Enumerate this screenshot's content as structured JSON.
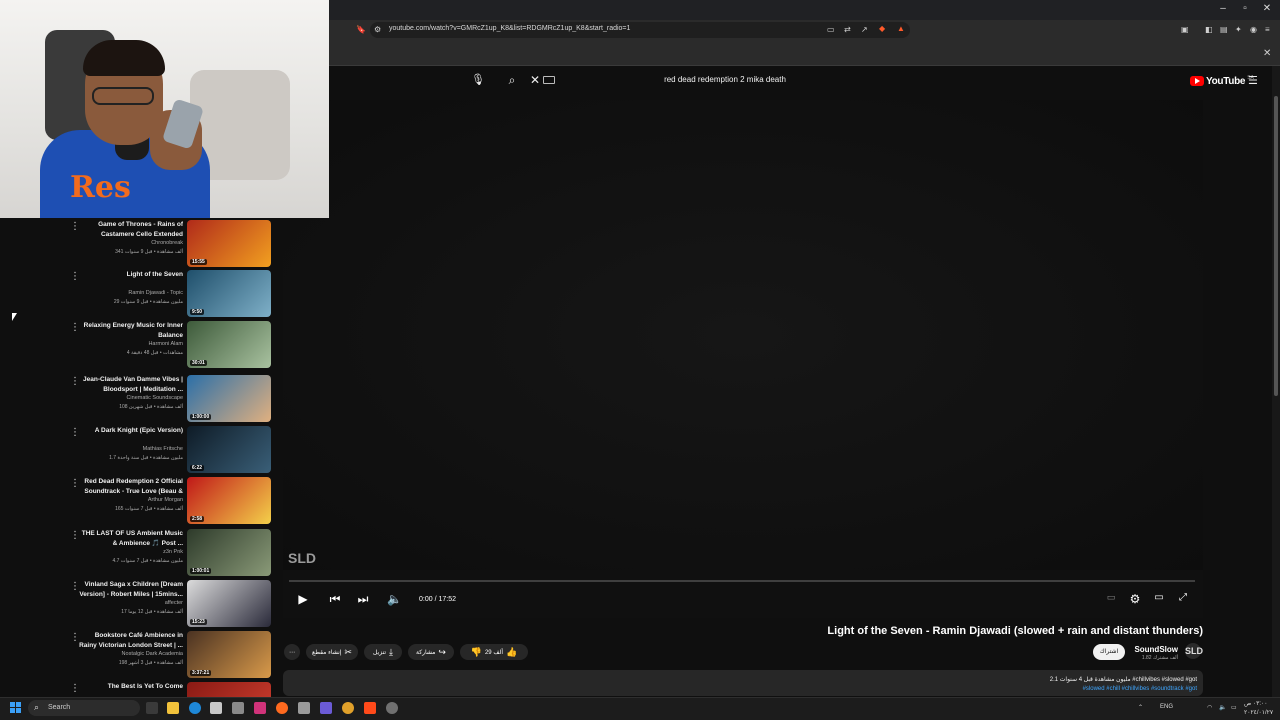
{
  "browser": {
    "url": "youtube.com/watch?v=GMRcZ1up_K8&list=RDGMRcZ1up_K8&start_radio=1",
    "window_controls": [
      "–",
      "▫",
      "✕"
    ]
  },
  "header": {
    "search_query": "red dead redemption 2 mika death",
    "logo_text": "YouTube",
    "logo_region": "SA"
  },
  "player": {
    "watermark": "SLD",
    "time": "0:00 / 17:52",
    "progress": 0
  },
  "video": {
    "title": "Light of the Seven - Ramin Djawadi (slowed + rain and distant thunders)",
    "channel": "SoundSlow",
    "subscribers": "1.82 ألف مشترك",
    "subscribe_label": "اشتراك",
    "like_count": "29 ألف",
    "share_label": "مشاركة",
    "download_label": "تنزيل",
    "clip_label": "إنشاء مقطع",
    "more_label": "⋯",
    "description_meta": "2.1 مليون مشاهدة قبل 4 سنوات #chillvibes #slowed #got",
    "description_tags": "#slowed #chill #chillvibes #soundtrack #got"
  },
  "recommendations": [
    {
      "title": "Game of Thrones - Rains of Castamere Cello Extended",
      "channel": "Chronobreak",
      "meta": "341 ألف مشاهدة • قبل 9 سنوات",
      "duration": "15:55",
      "thumb_color": "#b02a1a",
      "thumb_accent": "#f2a020"
    },
    {
      "title": "Light of the Seven",
      "channel": "Ramin Djawadi - Topic",
      "meta": "29 مليون مشاهدة • قبل 9 سنوات",
      "duration": "9:50",
      "thumb_color": "#1f4f6b",
      "thumb_accent": "#7fb0c8"
    },
    {
      "title": "Relaxing Energy Music for Inner Balance",
      "channel": "Harmoni Alam",
      "meta": "4 مشاهدات • قبل 48 دقيقة",
      "duration": "30:01",
      "thumb_color": "#3d5a3a",
      "thumb_accent": "#a9c2a0"
    },
    {
      "title": "Jean-Claude Van Damme Vibes | Bloodsport | Meditation ...",
      "channel": "Cinematic Soundscape",
      "meta": "108 ألف مشاهدة • قبل شهرين",
      "duration": "1:00:00",
      "thumb_color": "#2b6fa8",
      "thumb_accent": "#e0b080"
    },
    {
      "title": "A Dark Knight (Epic Version)",
      "channel": "Mathias Fritsche",
      "meta": "1.7 مليون مشاهدة • قبل سنة واحدة",
      "duration": "6:22",
      "thumb_color": "#0e1b26",
      "thumb_accent": "#3a5f78"
    },
    {
      "title": "Red Dead Redemption 2 Official Soundtrack - True Love (Beau & ...",
      "channel": "Arthur Morgan",
      "meta": "165 ألف مشاهدة • قبل 7 سنوات",
      "duration": "2:58",
      "thumb_color": "#c01818",
      "thumb_accent": "#f4d04a"
    },
    {
      "title": "THE LAST OF US Ambient Music & Ambience 🎵 Post ...",
      "channel": "z3n Pnk",
      "meta": "4.7 مليون مشاهدة • قبل 7 سنوات",
      "duration": "1:00:01",
      "thumb_color": "#2d3a2a",
      "thumb_accent": "#8a9a78"
    },
    {
      "title": "Vinland Saga x Children [Dream Version] - Robert Miles | 15mins...",
      "channel": "affecter",
      "meta": "17 ألف مشاهدة • قبل 12 يوما",
      "duration": "15:23",
      "thumb_color": "#dcdcdc",
      "thumb_accent": "#2a2a3a"
    },
    {
      "title": "Bookstore Café Ambience in Rainy Victorian London Street | ...",
      "channel": "Nostalgic Dark Academia",
      "meta": "198 ألف مشاهدة • قبل 3 أشهر",
      "duration": "3:37:21",
      "thumb_color": "#4a3222",
      "thumb_accent": "#d99a4a"
    },
    {
      "title": "The Best Is Yet To Come",
      "channel": "",
      "meta": "",
      "duration": "",
      "thumb_color": "#8a1a14",
      "thumb_accent": "#d04030"
    }
  ],
  "taskbar": {
    "search_label": "Search",
    "language": "ENG",
    "time": "٠٣:٠٠ ص",
    "date": "٢٠٢٤/٠١/٢٧"
  },
  "colors": {
    "background": "#0f0f0f",
    "accent_red": "#ff0000",
    "link_blue": "#3ea6ff"
  }
}
